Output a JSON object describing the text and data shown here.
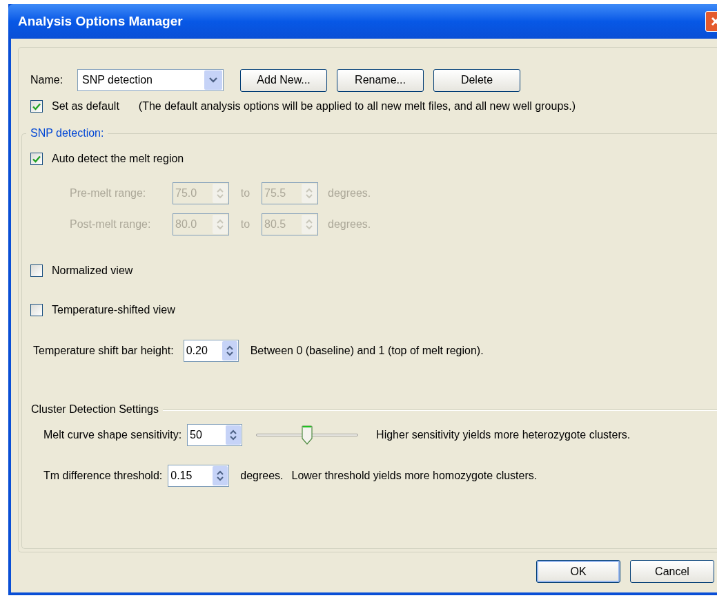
{
  "window": {
    "title": "Analysis Options Manager"
  },
  "name_row": {
    "label": "Name:",
    "dropdown": {
      "value": "SNP detection"
    },
    "buttons": [
      "Add New...",
      "Rename...",
      "Delete"
    ]
  },
  "set_default": {
    "label": "Set as default",
    "checked": true,
    "note": "(The default analysis options will be applied to all new melt files, and all new well groups.)"
  },
  "snp_group": {
    "title": "SNP detection:",
    "auto_detect": {
      "label": "Auto detect the melt region",
      "checked": true
    },
    "ranges": [
      {
        "label": "Pre-melt range:",
        "from": "75.0",
        "to_label": "to",
        "to": "75.5",
        "unit": "degrees.",
        "disabled": true
      },
      {
        "label": "Post-melt range:",
        "from": "80.0",
        "to_label": "to",
        "to": "80.5",
        "unit": "degrees.",
        "disabled": true
      }
    ],
    "options": [
      {
        "label": "Normalized view",
        "checked": false
      },
      {
        "label": "Temperature-shifted view",
        "checked": false
      }
    ],
    "shift": {
      "label": "Temperature shift bar height:",
      "value": "0.20",
      "note": "Between 0 (baseline) and 1 (top of melt region)."
    }
  },
  "cluster": {
    "title": "Cluster Detection Settings",
    "sensitivity": {
      "label": "Melt curve shape sensitivity:",
      "value": "50",
      "level": 0.5,
      "note": "Higher sensitivity yields more heterozygote clusters."
    },
    "threshold": {
      "label": "Tm difference threshold:",
      "value": "0.15",
      "unit": "degrees.",
      "note": "Lower threshold yields more homozygote clusters."
    }
  },
  "buttons": [
    {
      "label": "OK",
      "default": true
    },
    {
      "label": "Cancel",
      "default": false
    }
  ]
}
